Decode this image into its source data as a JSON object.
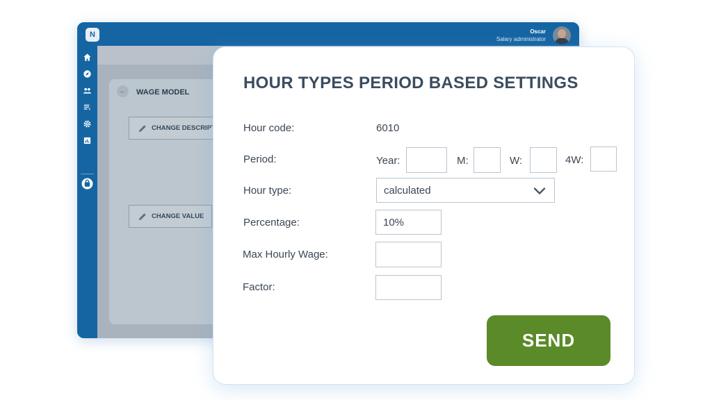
{
  "app": {
    "logo_text": "N",
    "user": {
      "name": "Oscar",
      "role": "Salary administrator"
    },
    "sidebar_icons": [
      "home-icon",
      "compass-icon",
      "users-icon",
      "list-icon",
      "gear-icon",
      "report-icon",
      "bag-icon"
    ],
    "card": {
      "title": "WAGE MODEL",
      "change_description_label": "CHANGE DESCRIPTION",
      "change_value_label": "CHANGE VALUE"
    }
  },
  "modal": {
    "title": "HOUR TYPES PERIOD BASED SETTINGS",
    "hour_code": {
      "label": "Hour code:",
      "value": "6010"
    },
    "period": {
      "label": "Period:",
      "year_label": "Year:",
      "year_value": "",
      "m_label": "M:",
      "m_value": "",
      "w_label": "W:",
      "w_value": "",
      "four_w_label": "4W:",
      "four_w_value": ""
    },
    "hour_type": {
      "label": "Hour type:",
      "value": "calculated"
    },
    "percentage": {
      "label": "Percentage:",
      "value": "10%"
    },
    "max_hourly_wage": {
      "label": "Max Hourly Wage:",
      "value": ""
    },
    "factor": {
      "label": "Factor:",
      "value": ""
    },
    "send_label": "SEND"
  },
  "colors": {
    "brand_blue": "#1565a3",
    "send_green": "#5b8a28",
    "title_text": "#3a4d60"
  }
}
